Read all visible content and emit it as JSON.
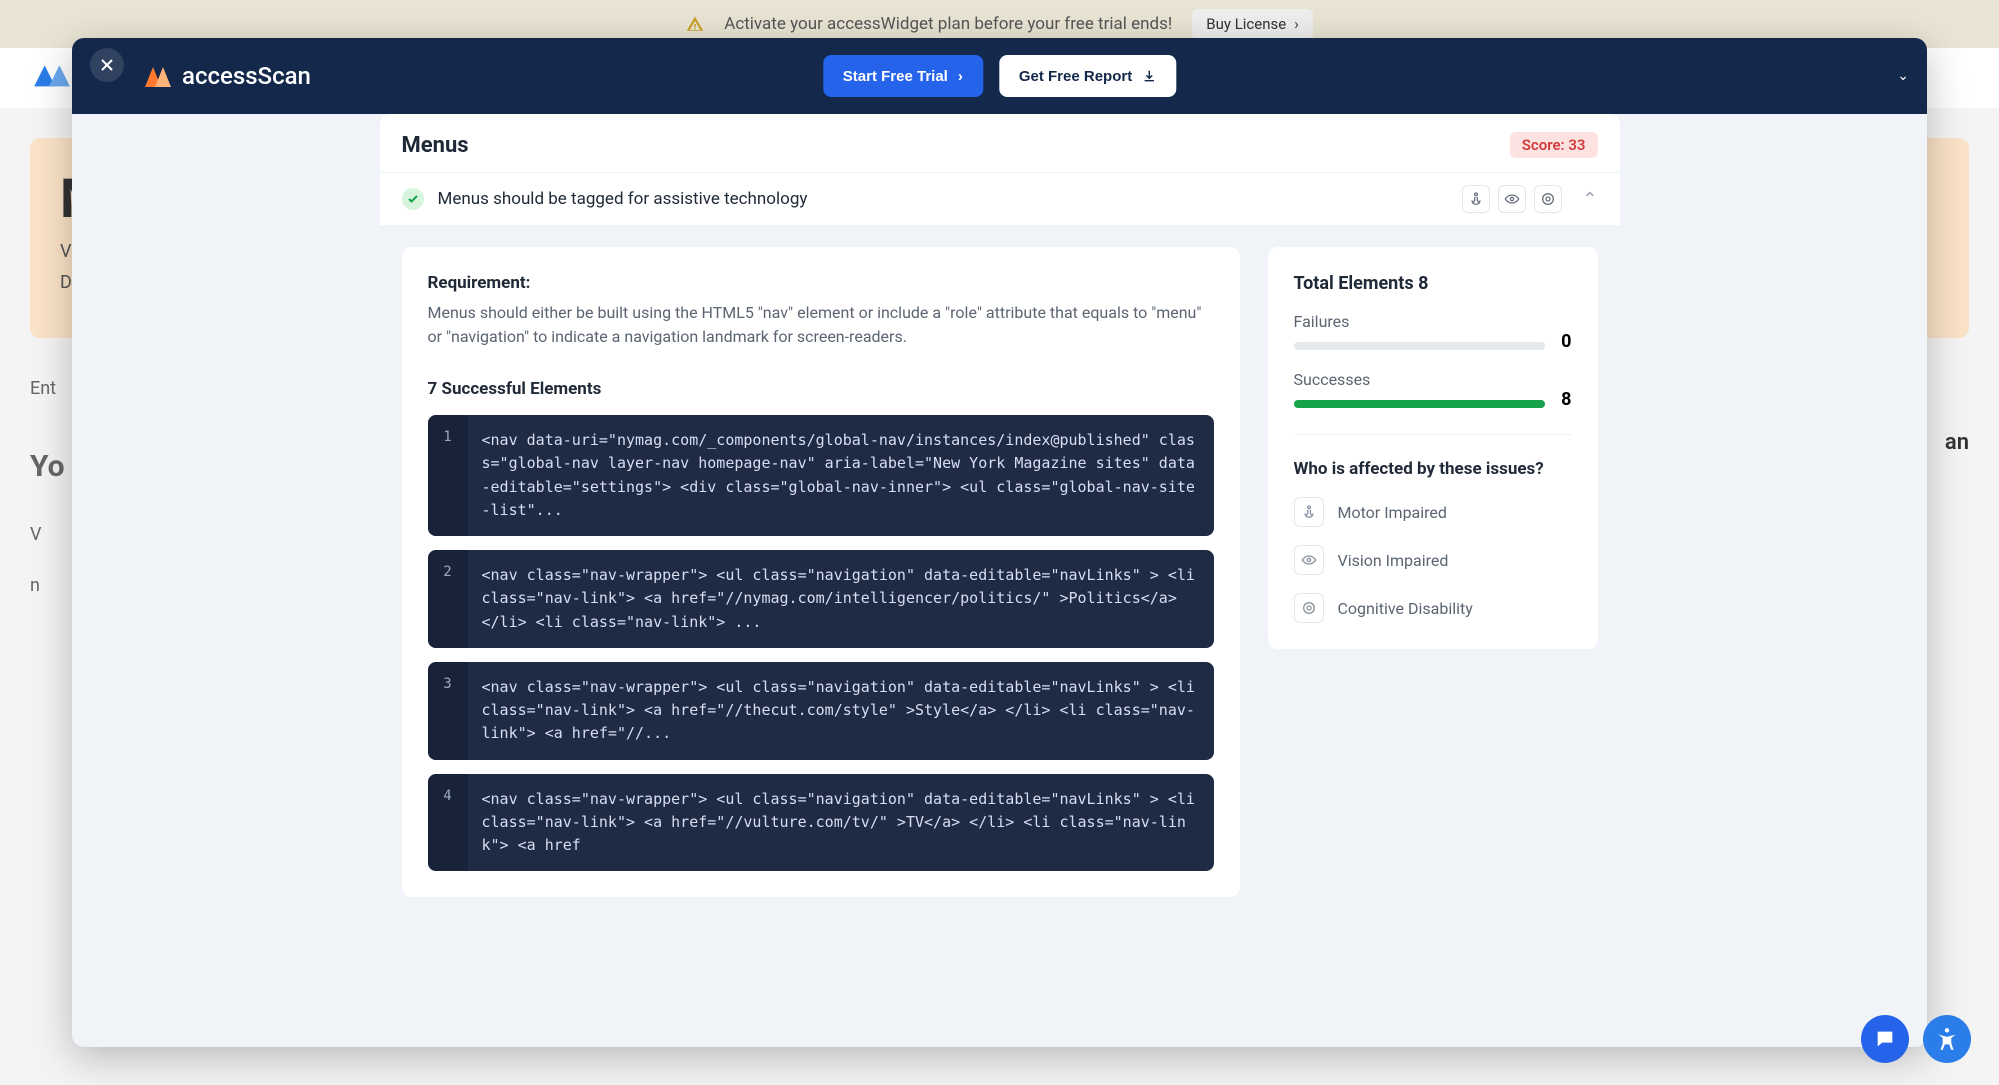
{
  "banner": {
    "text": "Activate your accessWidget plan before your free trial ends!",
    "buy_label": "Buy License"
  },
  "bg": {
    "hero_title": "M",
    "hero_sub1": "Vi",
    "hero_sub2": "Do",
    "enter_label": "Ent",
    "you_label": "Yo",
    "v_label": "V",
    "n_label": "n",
    "an_label": "an"
  },
  "modal": {
    "brand": "accessScan",
    "start_trial": "Start Free Trial",
    "get_report": "Get Free Report"
  },
  "section": {
    "title": "Menus",
    "score_label": "Score: 33"
  },
  "rule": {
    "label": "Menus should be tagged for assistive technology"
  },
  "detail": {
    "req_label": "Requirement:",
    "req_text": "Menus should either be built using the HTML5 \"nav\" element or include a \"role\" attribute that equals to \"menu\" or \"navigation\" to indicate a navigation landmark for screen-readers.",
    "subhead": "7 Successful Elements",
    "snippets": [
      "<nav data-uri=\"nymag.com/_components/global-nav/instances/index@published\" class=\"global-nav layer-nav homepage-nav\" aria-label=\"New York Magazine sites\" data-editable=\"settings\"> <div class=\"global-nav-inner\"> <ul class=\"global-nav-site-list\"...",
      "<nav class=\"nav-wrapper\"> <ul class=\"navigation\" data-editable=\"navLinks\" > <li class=\"nav-link\"> <a href=\"//nymag.com/intelligencer/politics/\" >Politics</a> </li> <li class=\"nav-link\"> ...",
      "<nav class=\"nav-wrapper\"> <ul class=\"navigation\" data-editable=\"navLinks\" > <li class=\"nav-link\"> <a href=\"//thecut.com/style\" >Style</a> </li> <li class=\"nav-link\"> <a href=\"//...",
      "<nav class=\"nav-wrapper\"> <ul class=\"navigation\" data-editable=\"navLinks\" > <li class=\"nav-link\"> <a href=\"//vulture.com/tv/\" >TV</a> </li> <li class=\"nav-link\"> <a href"
    ]
  },
  "stats": {
    "total_label": "Total Elements 8",
    "failures_label": "Failures",
    "failures_value": "0",
    "successes_label": "Successes",
    "successes_value": "8",
    "who_title": "Who is affected by these issues?",
    "who": [
      "Motor Impaired",
      "Vision Impaired",
      "Cognitive Disability"
    ]
  },
  "colors": {
    "primary": "#2563eb",
    "header": "#14284b",
    "success": "#17a34a",
    "score_bg": "#fde2e2",
    "score_fg": "#d23b3b"
  }
}
